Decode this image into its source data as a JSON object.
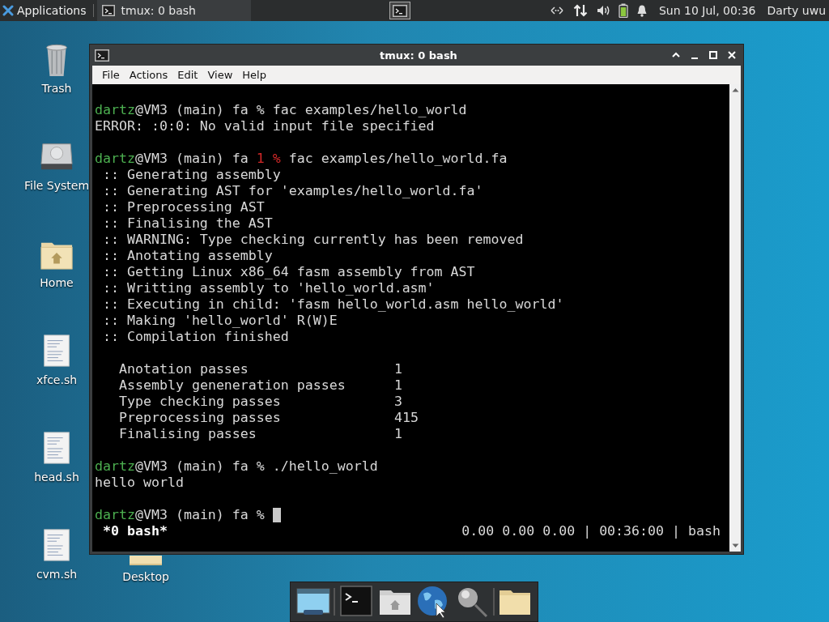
{
  "top_panel": {
    "applications_menu": "Applications",
    "tasks": [
      {
        "title": "tmux: 0 bash",
        "selected": true
      }
    ],
    "clock": "Sun 10 Jul, 00:36",
    "user": "Darty uwu"
  },
  "desktop_icons": [
    {
      "label": "Trash",
      "kind": "trash"
    },
    {
      "label": "File System",
      "kind": "drive"
    },
    {
      "label": "Home",
      "kind": "home"
    },
    {
      "label": "xfce.sh",
      "kind": "script"
    },
    {
      "label": "head.sh",
      "kind": "script"
    },
    {
      "label": "cvm.sh",
      "kind": "script"
    }
  ],
  "desktop_icon_partial": {
    "label": "Desktop",
    "kind": "folder"
  },
  "window": {
    "title": "tmux: 0 bash",
    "menu": [
      "File",
      "Actions",
      "Edit",
      "View",
      "Help"
    ],
    "lines": [
      {
        "kind": "blank"
      },
      {
        "kind": "text",
        "segments": [
          {
            "text": "dartz",
            "kind": "user"
          },
          {
            "text": "@VM3 (main) fa % fac examples/hello_world",
            "kind": "plain"
          }
        ]
      },
      {
        "kind": "text",
        "segments": [
          {
            "text": "ERROR: :0:0: No valid input file specified",
            "kind": "plain"
          }
        ]
      },
      {
        "kind": "blank"
      },
      {
        "kind": "text",
        "segments": [
          {
            "text": "dartz",
            "kind": "user"
          },
          {
            "text": "@VM3 (main) fa ",
            "kind": "plain"
          },
          {
            "text": "1 %",
            "kind": "error"
          },
          {
            "text": " fac examples/hello_world.fa",
            "kind": "plain"
          }
        ]
      },
      {
        "kind": "text",
        "segments": [
          {
            "text": " :: Generating assembly",
            "kind": "plain"
          }
        ]
      },
      {
        "kind": "text",
        "segments": [
          {
            "text": " :: Generating AST for 'examples/hello_world.fa'",
            "kind": "plain"
          }
        ]
      },
      {
        "kind": "text",
        "segments": [
          {
            "text": " :: Preprocessing AST",
            "kind": "plain"
          }
        ]
      },
      {
        "kind": "text",
        "segments": [
          {
            "text": " :: Finalising the AST",
            "kind": "plain"
          }
        ]
      },
      {
        "kind": "text",
        "segments": [
          {
            "text": " :: WARNING: Type checking currently has been removed",
            "kind": "plain"
          }
        ]
      },
      {
        "kind": "text",
        "segments": [
          {
            "text": " :: Anotating assembly",
            "kind": "plain"
          }
        ]
      },
      {
        "kind": "text",
        "segments": [
          {
            "text": " :: Getting Linux x86_64 fasm assembly from AST",
            "kind": "plain"
          }
        ]
      },
      {
        "kind": "text",
        "segments": [
          {
            "text": " :: Writting assembly to 'hello_world.asm'",
            "kind": "plain"
          }
        ]
      },
      {
        "kind": "text",
        "segments": [
          {
            "text": " :: Executing in child: 'fasm hello_world.asm hello_world'",
            "kind": "plain"
          }
        ]
      },
      {
        "kind": "text",
        "segments": [
          {
            "text": " :: Making 'hello_world' R(W)E",
            "kind": "plain"
          }
        ]
      },
      {
        "kind": "text",
        "segments": [
          {
            "text": " :: Compilation finished",
            "kind": "plain"
          }
        ]
      },
      {
        "kind": "blank"
      },
      {
        "kind": "stat",
        "label": "Anotation passes",
        "value": "1"
      },
      {
        "kind": "stat",
        "label": "Assembly geneneration passes",
        "value": "1"
      },
      {
        "kind": "stat",
        "label": "Type checking passes",
        "value": "3"
      },
      {
        "kind": "stat",
        "label": "Preprocessing passes",
        "value": "415"
      },
      {
        "kind": "stat",
        "label": "Finalising passes",
        "value": "1"
      },
      {
        "kind": "blank"
      },
      {
        "kind": "text",
        "segments": [
          {
            "text": "dartz",
            "kind": "user"
          },
          {
            "text": "@VM3 (main) fa % ./hello_world",
            "kind": "plain"
          }
        ]
      },
      {
        "kind": "text",
        "segments": [
          {
            "text": "hello world",
            "kind": "plain"
          }
        ]
      },
      {
        "kind": "blank"
      },
      {
        "kind": "text",
        "cursor": true,
        "segments": [
          {
            "text": "dartz",
            "kind": "user"
          },
          {
            "text": "@VM3 (main) fa % ",
            "kind": "plain"
          }
        ]
      }
    ],
    "tmux_status": {
      "window": "*0 bash*",
      "right": "0.00 0.00 0.00 | 00:36:00 | bash"
    }
  },
  "dock": [
    {
      "kind": "desktop"
    },
    {
      "kind": "terminal"
    },
    {
      "kind": "home"
    },
    {
      "kind": "globe"
    },
    {
      "kind": "search"
    },
    {
      "kind": "folder"
    }
  ]
}
